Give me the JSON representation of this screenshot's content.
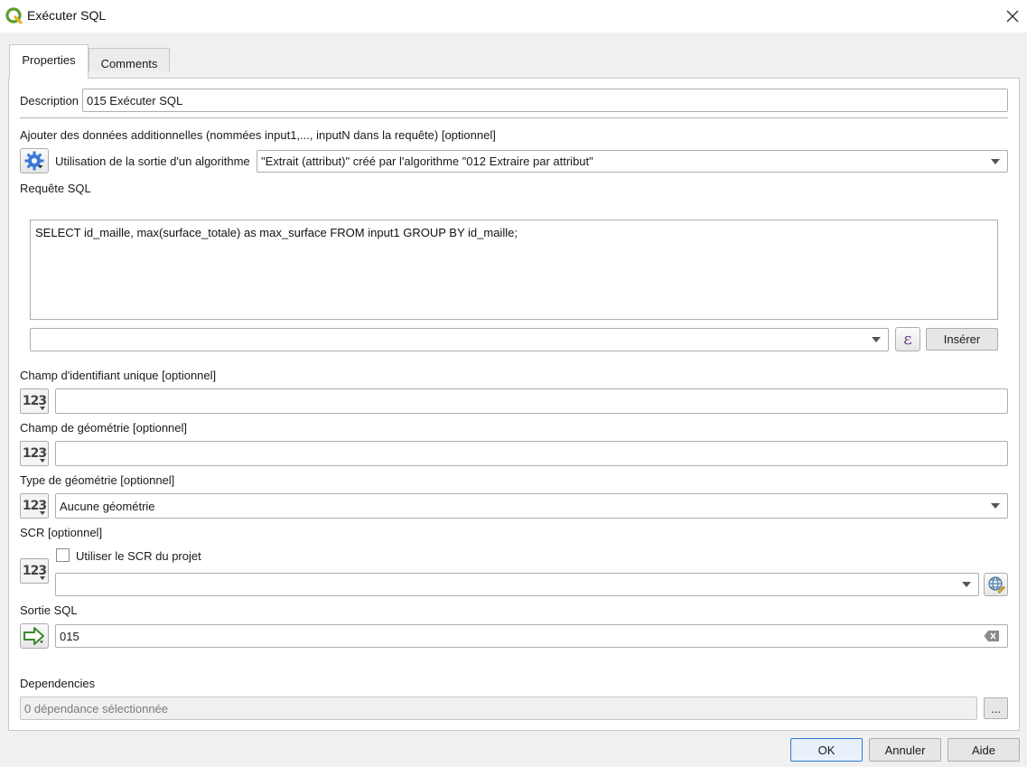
{
  "window": {
    "title": "Exécuter SQL"
  },
  "tabs": [
    {
      "label": "Properties",
      "active": true
    },
    {
      "label": "Comments",
      "active": false
    }
  ],
  "description": {
    "label": "Description",
    "value": "015 Exécuter SQL"
  },
  "additional_data": {
    "label": "Ajouter des données additionnelles (nommées input1,..., inputN dans la requête) [optionnel]",
    "source_label": "Utilisation de la sortie d'un algorithme",
    "selected": "\"Extrait (attribut)\" créé par l'algorithme \"012 Extraire par attribut\""
  },
  "sql_query": {
    "label": "Requête SQL",
    "value": "SELECT id_maille, max(surface_totale) as max_surface FROM input1 GROUP BY id_maille;",
    "insert_combo_value": "",
    "insert_button": "Insérer"
  },
  "unique_id_field": {
    "label": "Champ d'identifiant unique [optionnel]",
    "value": ""
  },
  "geometry_field": {
    "label": "Champ de géométrie [optionnel]",
    "value": ""
  },
  "geometry_type": {
    "label": "Type de géométrie [optionnel]",
    "value": "Aucune géométrie"
  },
  "crs": {
    "label": "SCR [optionnel]",
    "use_project_crs_label": "Utiliser le SCR du projet",
    "use_project_crs_checked": false,
    "value": ""
  },
  "sql_output": {
    "label": "Sortie SQL",
    "value": "015"
  },
  "dependencies": {
    "label": "Dependencies",
    "value": "0 dépendance sélectionnée",
    "browse_label": "..."
  },
  "buttons": {
    "ok": "OK",
    "cancel": "Annuler",
    "help": "Aide"
  },
  "colors": {
    "accent": "#2f79d6",
    "qgis_green": "#5c9e2e",
    "gear_blue": "#3c78d8"
  }
}
